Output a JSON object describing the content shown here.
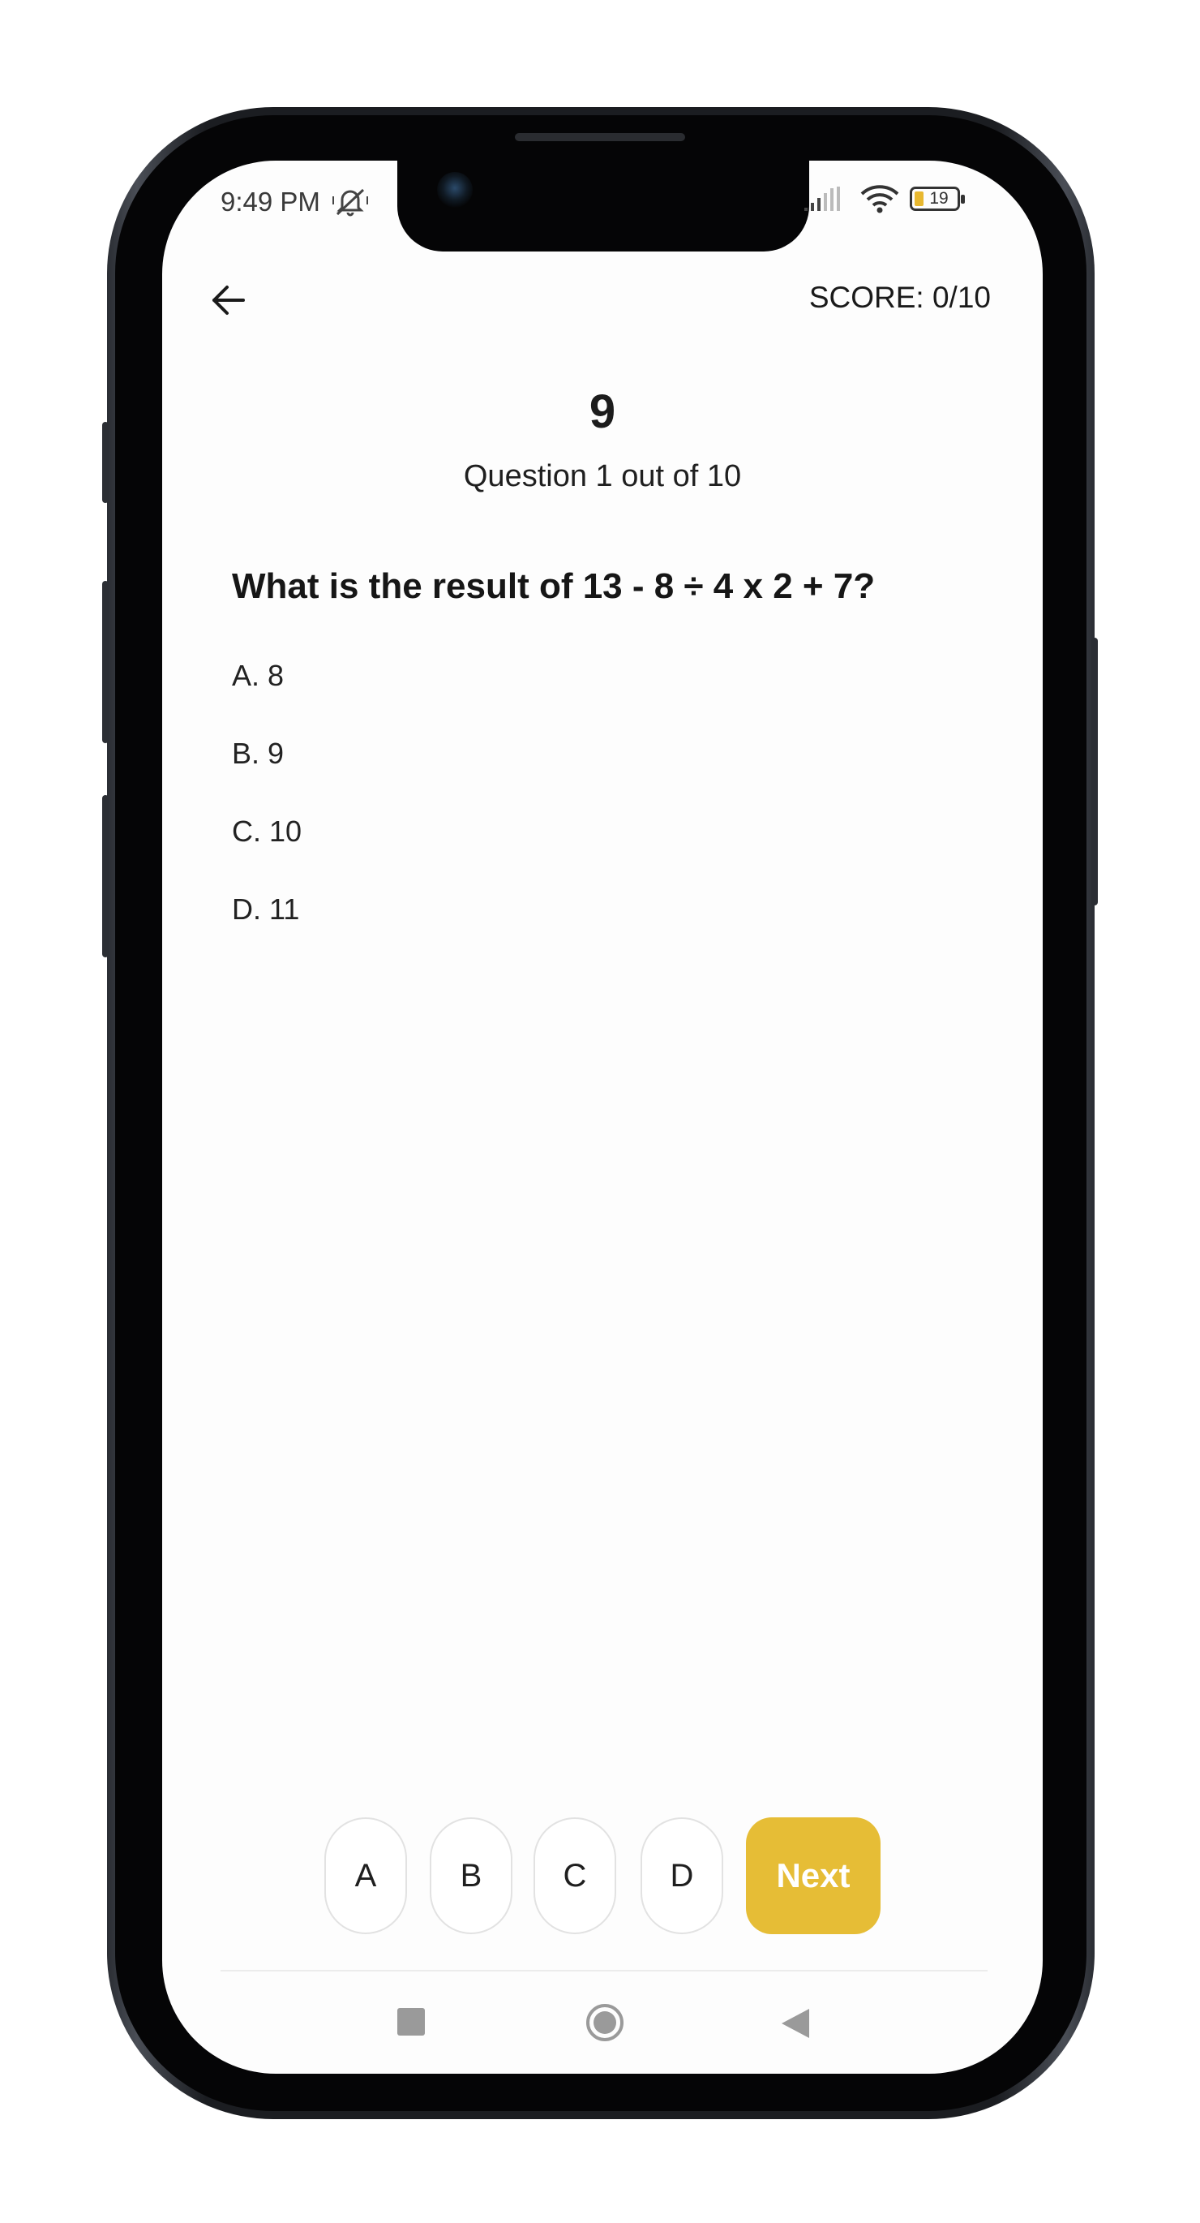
{
  "status_bar": {
    "time": "9:49 PM",
    "battery": "19",
    "icons": [
      "mute-icon",
      "signal-icon",
      "wifi-icon",
      "battery-icon"
    ]
  },
  "header": {
    "back_icon": "arrow-left-icon",
    "score": "SCORE: 0/10"
  },
  "quiz": {
    "timer": "9",
    "progress": "Question 1 out of 10",
    "question": "What is the result of 13 - 8 ÷ 4 x 2 + 7?",
    "options": [
      "A. 8",
      "B. 9",
      "C. 10",
      "D. 11"
    ]
  },
  "answers": {
    "buttons": [
      "A",
      "B",
      "C",
      "D"
    ],
    "next_label": "Next",
    "accent_color": "#e6bd36"
  },
  "nav_bar": {
    "icons": [
      "recents-square-icon",
      "home-circle-icon",
      "back-triangle-icon"
    ]
  }
}
